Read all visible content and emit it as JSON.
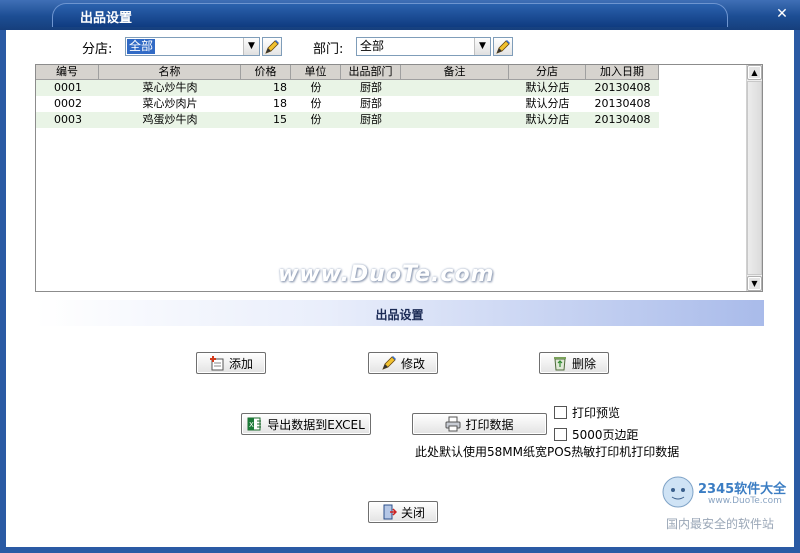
{
  "window": {
    "title": "出品设置"
  },
  "filters": {
    "branch_label": "分店:",
    "branch_value": "全部",
    "dept_label": "部门:",
    "dept_value": "全部"
  },
  "grid": {
    "columns": [
      "编号",
      "名称",
      "价格",
      "单位",
      "出品部门",
      "备注",
      "分店",
      "加入日期"
    ],
    "rows": [
      [
        "0001",
        "菜心炒牛肉",
        "18",
        "份",
        "厨部",
        "",
        "默认分店",
        "20130408"
      ],
      [
        "0002",
        "菜心炒肉片",
        "18",
        "份",
        "厨部",
        "",
        "默认分店",
        "20130408"
      ],
      [
        "0003",
        "鸡蛋炒牛肉",
        "15",
        "份",
        "厨部",
        "",
        "默认分店",
        "20130408"
      ]
    ]
  },
  "watermark": "www.DuoTe.com",
  "section_title": "出品设置",
  "buttons": {
    "add": "添加",
    "edit": "修改",
    "delete": "删除",
    "export": "导出数据到EXCEL",
    "print": "打印数据",
    "close": "关闭"
  },
  "options": {
    "preview": "打印预览",
    "margin": "5000页边距"
  },
  "print_note": "此处默认使用58MM纸宽POS热敏打印机打印数据",
  "logo": {
    "brand": "2345软件大全",
    "url": "www.DuoTe.com",
    "slogan": "国内最安全的软件站"
  }
}
